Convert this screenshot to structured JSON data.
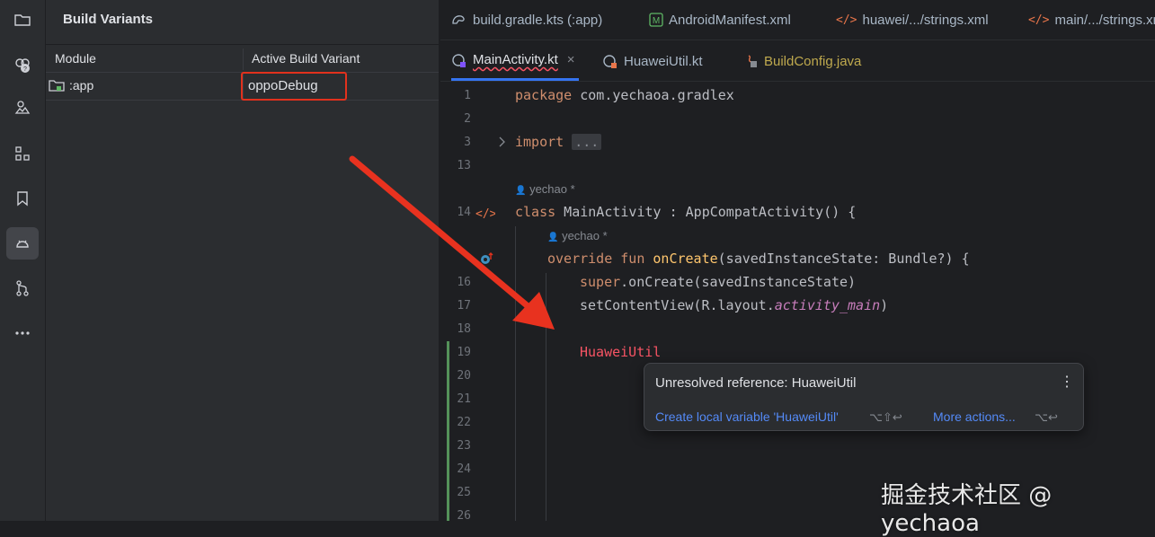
{
  "build_variants": {
    "title": "Build Variants",
    "columns": [
      "Module",
      "Active Build Variant"
    ],
    "rows": [
      {
        "module": ":app",
        "variant": "oppoDebug"
      }
    ]
  },
  "tabs_row1": [
    {
      "label": "build.gradle.kts (:app)",
      "icon": "gradle-icon"
    },
    {
      "label": "AndroidManifest.xml",
      "icon": "manifest-icon"
    },
    {
      "label": "huawei/.../strings.xml",
      "icon": "xml-icon"
    },
    {
      "label": "main/.../strings.xml",
      "icon": "xml-icon"
    }
  ],
  "tabs_row2": [
    {
      "label": "MainActivity.kt",
      "icon": "kotlin-class-icon",
      "active": true,
      "close": "×"
    },
    {
      "label": "HuaweiUtil.kt",
      "icon": "kotlin-class-icon"
    },
    {
      "label": "BuildConfig.java",
      "icon": "java-lock-icon"
    }
  ],
  "editor": {
    "line_numbers": [
      "1",
      "2",
      "3",
      "13",
      "14",
      "",
      "16",
      "17",
      "18",
      "19",
      "20",
      "21",
      "22",
      "23",
      "24",
      "25",
      "26"
    ],
    "author_hint_1": "yechao *",
    "author_hint_2": "yechao *",
    "code": {
      "l1_kw": "package",
      "l1_rest": " com.yechaoa.gradlex",
      "l3_kw": "import",
      "l3_fold": "...",
      "l14_kw": "class",
      "l14_rest": " MainActivity : AppCompatActivity() {",
      "l15_kw": "override fun",
      "l15_fn": "onCreate",
      "l15_rest": "(savedInstanceState: Bundle?) {",
      "l16_kw": "super",
      "l16_rest": ".onCreate(savedInstanceState)",
      "l17_a": "setContentView(R.layout.",
      "l17_b": "activity_main",
      "l17_c": ")",
      "l19_err": "HuaweiUtil"
    }
  },
  "popup": {
    "message": "Unresolved reference: HuaweiUtil",
    "fix_label": "Create local variable 'HuaweiUtil'",
    "fix_shortcut": "⌥⇧↩",
    "more_label": "More actions...",
    "more_shortcut": "⌥↩"
  },
  "watermark": "掘金技术社区 @ yechaoa",
  "colors": {
    "highlight_box": "#e2311d",
    "arrow": "#e8321f",
    "link": "#548af7",
    "keyword": "#cf8e6d",
    "error": "#f75464"
  }
}
